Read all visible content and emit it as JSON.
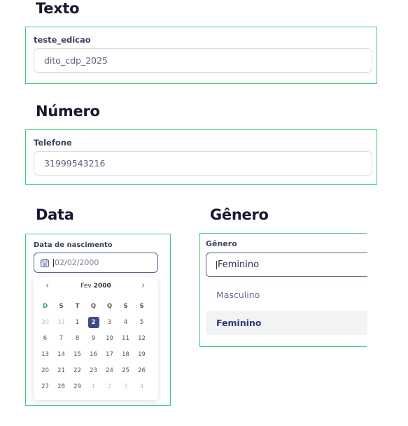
{
  "sections": {
    "texto": {
      "heading": "Texto",
      "label": "teste_edicao",
      "value": "dito_cdp_2025"
    },
    "numero": {
      "heading": "Número",
      "label": "Telefone",
      "value": "31999543216"
    },
    "data": {
      "heading": "Data",
      "label": "Data de nascimento",
      "value": "02/02/2000",
      "icon": "calendar-icon",
      "calendar": {
        "month": "Fev",
        "year": "2000",
        "prev_icon": "‹",
        "next_icon": "›",
        "weekdays": [
          "D",
          "S",
          "T",
          "Q",
          "Q",
          "S",
          "S"
        ],
        "weeks": [
          [
            "30",
            "31",
            "1",
            "2",
            "3",
            "4",
            "5"
          ],
          [
            "6",
            "7",
            "8",
            "9",
            "10",
            "11",
            "12"
          ],
          [
            "13",
            "14",
            "15",
            "16",
            "17",
            "18",
            "19"
          ],
          [
            "20",
            "21",
            "22",
            "23",
            "24",
            "25",
            "26"
          ],
          [
            "27",
            "28",
            "29",
            "1",
            "2",
            "3",
            "4"
          ]
        ],
        "selected_day": "2"
      }
    },
    "genero": {
      "heading": "Gênero",
      "label": "Gênero",
      "value": "Feminino",
      "options": [
        "Masculino",
        "Feminino"
      ],
      "selected_option": "Feminino"
    }
  },
  "colors": {
    "frame_border": "#3ccf7a",
    "selected_day_bg": "#3f4a8a",
    "sunday_color": "#23a552"
  }
}
